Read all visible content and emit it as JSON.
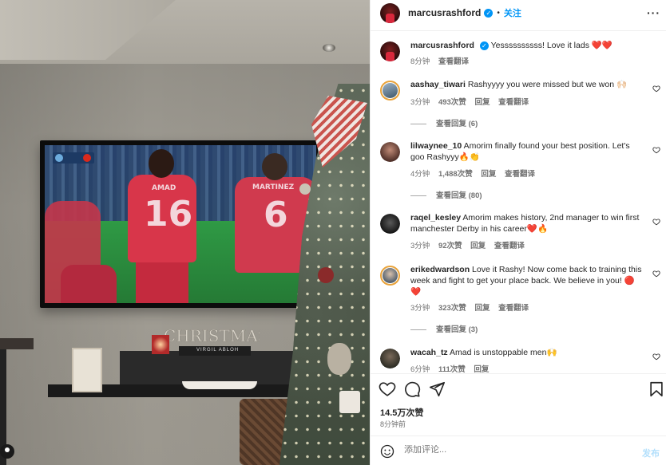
{
  "post": {
    "author": "marcusrashford",
    "follow_label": "关注",
    "caption_author": "marcusrashford",
    "caption_text": "Yessssssssss! Love it lads ❤️❤️",
    "caption_time": "8分钟",
    "caption_translate": "查看翻译"
  },
  "comments": [
    {
      "user": "aashay_tiwari",
      "text": "Rashyyyy you were missed but we won 🙌🏻",
      "time": "3分钟",
      "likes": "493次赞",
      "reply": "回复",
      "translate": "查看翻译",
      "view_replies": "查看回复 (6)"
    },
    {
      "user": "lilwaynee_10",
      "text": "Amorim finally found your best position. Let's goo Rashyyy🔥👏",
      "time": "4分钟",
      "likes": "1,488次赞",
      "reply": "回复",
      "translate": "查看翻译",
      "view_replies": "查看回复 (80)"
    },
    {
      "user": "raqel_kesley",
      "text": "Amorim makes history, 2nd manager to win first manchester Derby in his career❤️🔥",
      "time": "3分钟",
      "likes": "92次赞",
      "reply": "回复",
      "translate": "查看翻译",
      "view_replies": ""
    },
    {
      "user": "erikedwardson",
      "text": "Love it Rashy! Now come back to training this week and fight to get your place back. We believe in you! 🔴❤️",
      "time": "3分钟",
      "likes": "323次赞",
      "reply": "回复",
      "translate": "查看翻译",
      "view_replies": "查看回复 (3)"
    },
    {
      "user": "wacah_tz",
      "text": "Amad is unstoppable men🙌",
      "time": "6分钟",
      "likes": "111次赞",
      "reply": "回复",
      "translate": "",
      "view_replies": ""
    }
  ],
  "stats": {
    "likes": "14.5万次赞",
    "time": "8分钟前"
  },
  "composer": {
    "placeholder": "添加评论...",
    "post_label": "发布"
  },
  "tv": {
    "player_left_name": "AMAD",
    "player_left_number": "16",
    "player_right_name": "MARTINEZ",
    "player_right_number": "6"
  },
  "decor": {
    "sign": "CHRISTMAS",
    "book": "VIRGIL ABLOH"
  },
  "colors": {
    "link": "#0095f6",
    "muted": "#737373",
    "text": "#262626"
  },
  "icons": [
    "more-icon",
    "verified-icon",
    "heart-icon",
    "comment-icon",
    "share-icon",
    "bookmark-icon",
    "emoji-icon"
  ]
}
